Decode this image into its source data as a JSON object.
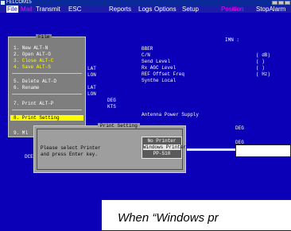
{
  "window": {
    "title": "FELCOM15"
  },
  "menu": {
    "file": "File",
    "mail": "Mail",
    "transmit": "Transmit",
    "esc": "ESC",
    "reports": "Reports",
    "logs": "Logs",
    "options": "Options",
    "setup": "Setup",
    "position": "Position",
    "stopalarm": "StopAlarm"
  },
  "file_menu": {
    "title": "File",
    "items": [
      "1. New   ALT-N",
      "2. Open  ALT-O",
      "3. Close ALT-C",
      "4. Save  ALT-S",
      "5. Delete ALT-D",
      "6. Rename",
      "7. Print  ALT-P",
      "8. Print Setting",
      "9. Ml"
    ]
  },
  "status": {
    "imn": "IMN :",
    "lat1": "LAT",
    "lon1": "LON",
    "lat2": "LAT",
    "lon2": "LON",
    "deg1": "DEG",
    "kts": "KTS",
    "bber": "BBER",
    "cn": "C/N",
    "send_level": "Send Level",
    "rx_agc": "Rx AGC Level",
    "ref_offset": "REF Offset Freq",
    "synth": "Synthe Local",
    "unit_db": "(    dB)",
    "paren1": "(    )",
    "paren2": "(    )",
    "unit_hz": "(     Hz)",
    "antenna": "Antenna Power Supply",
    "deg2": "DEG",
    "deg3": "DEG",
    "dce": "DCE"
  },
  "print_dialog": {
    "title": "Print Setting",
    "message_line1": "Please select Printer",
    "message_line2": "and press Enter key.",
    "options": [
      "No Printer",
      "Windows Printer",
      "PP-510"
    ],
    "selected": "Windows Printer"
  },
  "caption": "When “Windows pr"
}
